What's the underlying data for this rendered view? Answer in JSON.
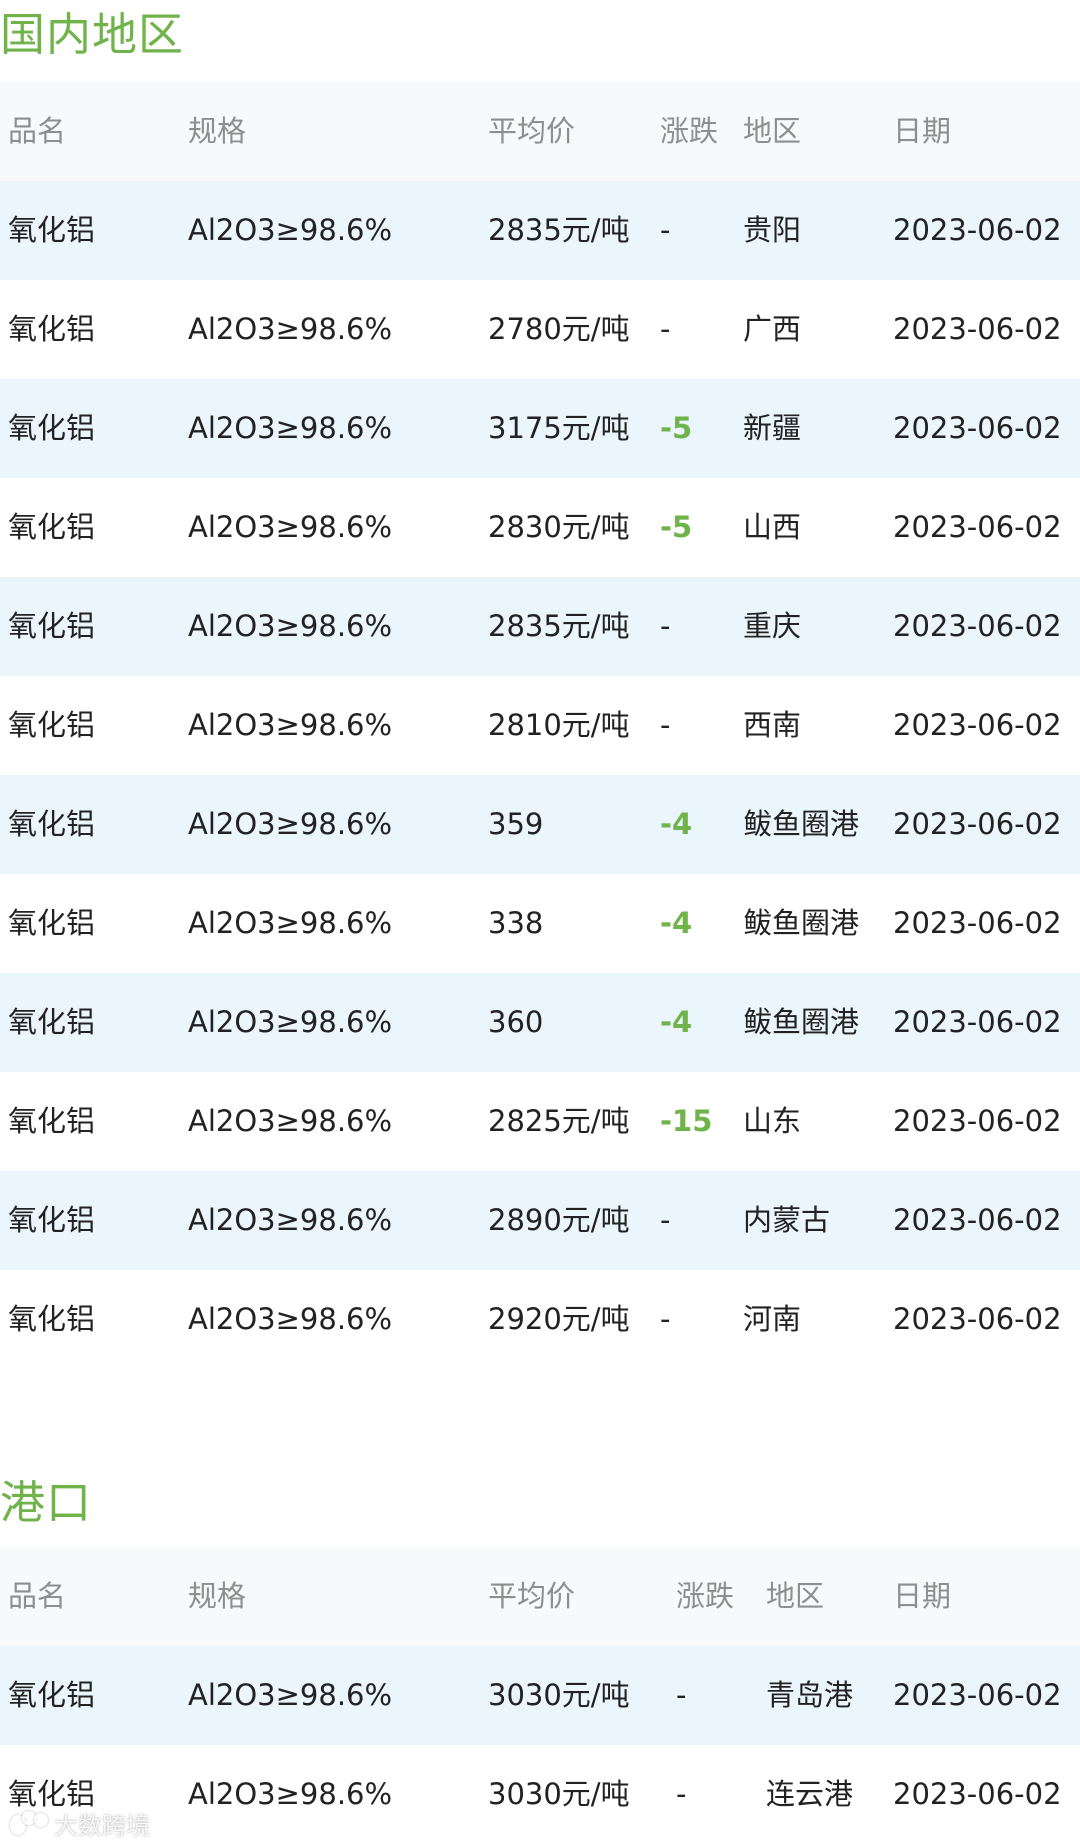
{
  "sections": [
    {
      "title": "国内地区",
      "headers": [
        "品名",
        "规格",
        "平均价",
        "涨跌",
        "地区",
        "日期"
      ],
      "rows": [
        {
          "name": "氧化铝",
          "spec": "Al2O3≥98.6%",
          "price": "2835元/吨",
          "change": "-",
          "region": "贵阳",
          "date": "2023-06-02"
        },
        {
          "name": "氧化铝",
          "spec": "Al2O3≥98.6%",
          "price": "2780元/吨",
          "change": "-",
          "region": "广西",
          "date": "2023-06-02"
        },
        {
          "name": "氧化铝",
          "spec": "Al2O3≥98.6%",
          "price": "3175元/吨",
          "change": "-5",
          "region": "新疆",
          "date": "2023-06-02"
        },
        {
          "name": "氧化铝",
          "spec": "Al2O3≥98.6%",
          "price": "2830元/吨",
          "change": "-5",
          "region": "山西",
          "date": "2023-06-02"
        },
        {
          "name": "氧化铝",
          "spec": "Al2O3≥98.6%",
          "price": "2835元/吨",
          "change": "-",
          "region": "重庆",
          "date": "2023-06-02"
        },
        {
          "name": "氧化铝",
          "spec": "Al2O3≥98.6%",
          "price": "2810元/吨",
          "change": "-",
          "region": "西南",
          "date": "2023-06-02"
        },
        {
          "name": "氧化铝",
          "spec": "Al2O3≥98.6%",
          "price": "359",
          "change": "-4",
          "region": "鲅鱼圈港",
          "date": "2023-06-02"
        },
        {
          "name": "氧化铝",
          "spec": "Al2O3≥98.6%",
          "price": "338",
          "change": "-4",
          "region": "鲅鱼圈港",
          "date": "2023-06-02"
        },
        {
          "name": "氧化铝",
          "spec": "Al2O3≥98.6%",
          "price": "360",
          "change": "-4",
          "region": "鲅鱼圈港",
          "date": "2023-06-02"
        },
        {
          "name": "氧化铝",
          "spec": "Al2O3≥98.6%",
          "price": "2825元/吨",
          "change": "-15",
          "region": "山东",
          "date": "2023-06-02"
        },
        {
          "name": "氧化铝",
          "spec": "Al2O3≥98.6%",
          "price": "2890元/吨",
          "change": "-",
          "region": "内蒙古",
          "date": "2023-06-02"
        },
        {
          "name": "氧化铝",
          "spec": "Al2O3≥98.6%",
          "price": "2920元/吨",
          "change": "-",
          "region": "河南",
          "date": "2023-06-02"
        }
      ]
    },
    {
      "title": "港口",
      "headers": [
        "品名",
        "规格",
        "平均价",
        "涨跌",
        "地区",
        "日期"
      ],
      "rows": [
        {
          "name": "氧化铝",
          "spec": "Al2O3≥98.6%",
          "price": "3030元/吨",
          "change": "-",
          "region": "青岛港",
          "date": "2023-06-02"
        },
        {
          "name": "氧化铝",
          "spec": "Al2O3≥98.6%",
          "price": "3030元/吨",
          "change": "-",
          "region": "连云港",
          "date": "2023-06-02"
        }
      ]
    }
  ],
  "watermark": "大数跨境",
  "colors": {
    "accent": "#6fb34a",
    "row_alt": "#ebf6fc",
    "header_bg": "#f8f9fa",
    "header_text": "#8e8e8e"
  }
}
